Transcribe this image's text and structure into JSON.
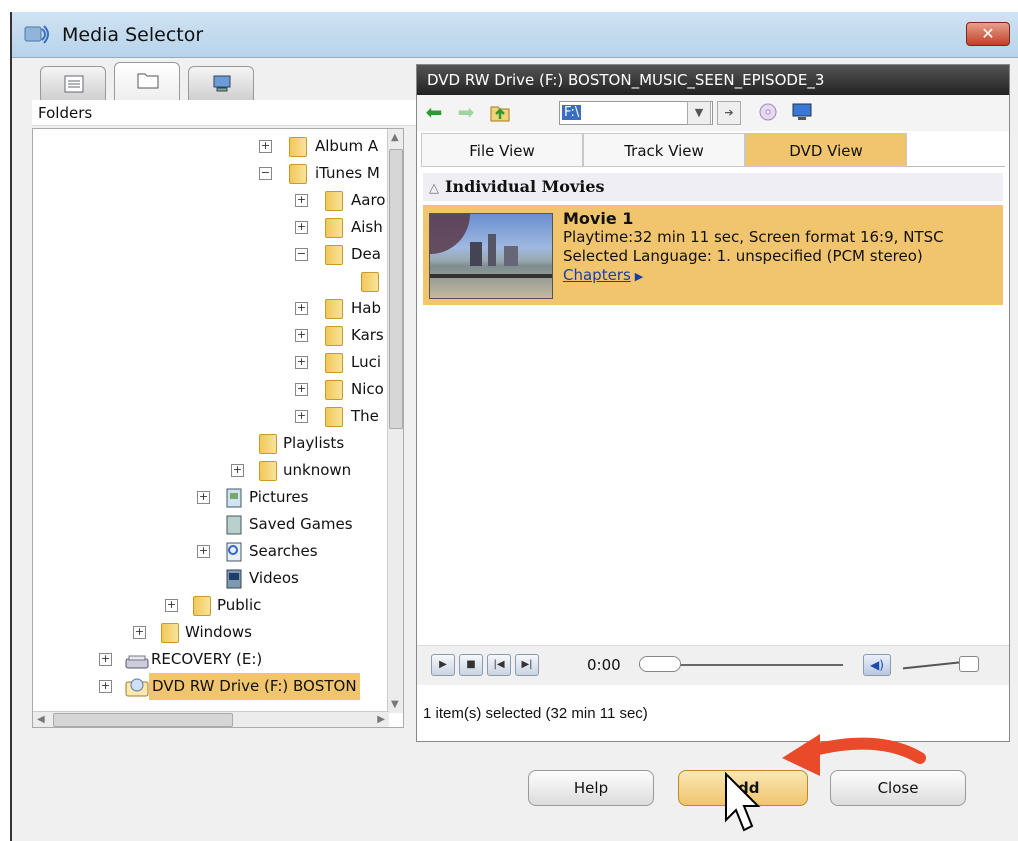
{
  "window": {
    "title": "Media Selector",
    "close_label": "✕",
    "accent_color": "#f1c46e"
  },
  "left_panel": {
    "tabs": [
      {
        "icon": "list-view-icon"
      },
      {
        "icon": "folder-icon"
      },
      {
        "icon": "computer-icon"
      }
    ],
    "header": "Folders",
    "tree": [
      {
        "label": "Album A",
        "expander": "+"
      },
      {
        "label": "iTunes M",
        "expander": "−"
      },
      {
        "label": "Aaro",
        "expander": "+"
      },
      {
        "label": "Aish",
        "expander": "+"
      },
      {
        "label": "Dea",
        "expander": "−"
      },
      {
        "label": "",
        "expander": ""
      },
      {
        "label": "Hab",
        "expander": "+"
      },
      {
        "label": "Kars",
        "expander": "+"
      },
      {
        "label": "Luci",
        "expander": "+"
      },
      {
        "label": "Nico",
        "expander": "+"
      },
      {
        "label": "The",
        "expander": "+"
      },
      {
        "label": "Playlists",
        "expander": ""
      },
      {
        "label": "unknown",
        "expander": "+"
      },
      {
        "label": "Pictures",
        "expander": "+"
      },
      {
        "label": "Saved Games",
        "expander": ""
      },
      {
        "label": "Searches",
        "expander": "+"
      },
      {
        "label": "Videos",
        "expander": ""
      },
      {
        "label": "Public",
        "expander": "+"
      },
      {
        "label": "Windows",
        "expander": "+"
      },
      {
        "label": "RECOVERY (E:)",
        "expander": "+"
      },
      {
        "label": "DVD RW Drive (F:) BOSTON",
        "expander": "+"
      }
    ]
  },
  "right_panel": {
    "title": "DVD RW Drive (F:) BOSTON_MUSIC_SEEN_EPISODE_3",
    "path": "F:\\",
    "tabs": [
      "File View",
      "Track View",
      "DVD View"
    ],
    "active_tab": "DVD View",
    "section_title": "Individual Movies",
    "movie": {
      "title": "Movie 1",
      "playtime": "Playtime:32 min 11 sec, Screen format 16:9, NTSC",
      "language": "Selected Language: 1. unspecified (PCM stereo)",
      "chapters_link": "Chapters"
    },
    "player": {
      "time": "0:00"
    },
    "status": "1 item(s) selected (32 min 11 sec)"
  },
  "buttons": {
    "help": "Help",
    "add": "Add",
    "close": "Close"
  }
}
